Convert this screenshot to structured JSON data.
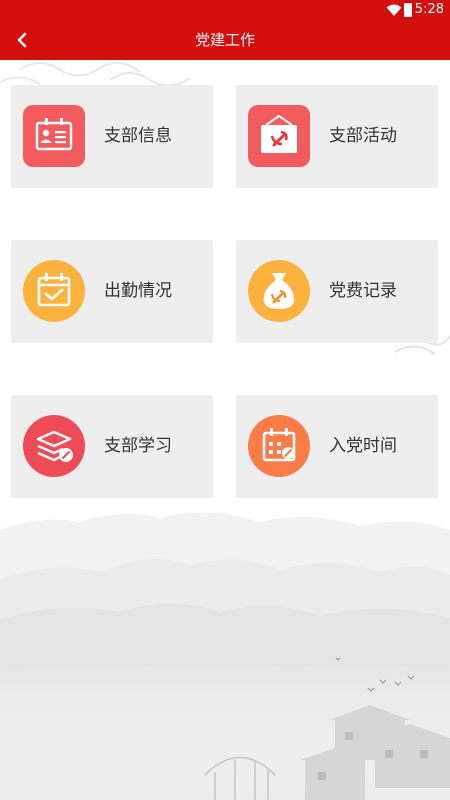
{
  "status_bar": {
    "time": "5:28",
    "icons": [
      "wifi-icon",
      "battery-icon"
    ]
  },
  "app_bar": {
    "title": "党建工作",
    "back_icon": "back-chevron-icon"
  },
  "tiles": [
    {
      "label": "支部信息",
      "icon": "id-card-icon",
      "color": "#f35b5f"
    },
    {
      "label": "支部活动",
      "icon": "activity-sign-icon",
      "color": "#f35b5f"
    },
    {
      "label": "出勤情况",
      "icon": "calendar-check-icon",
      "color": "#fcb23c"
    },
    {
      "label": "党费记录",
      "icon": "money-bag-icon",
      "color": "#fcb23c"
    },
    {
      "label": "支部学习",
      "icon": "study-books-icon",
      "color": "#ef4b56"
    },
    {
      "label": "入党时间",
      "icon": "calendar-date-icon",
      "color": "#fb7c46"
    }
  ],
  "colors": {
    "brand_red": "#d40d0d",
    "tile_bg": "#eeeeee"
  }
}
